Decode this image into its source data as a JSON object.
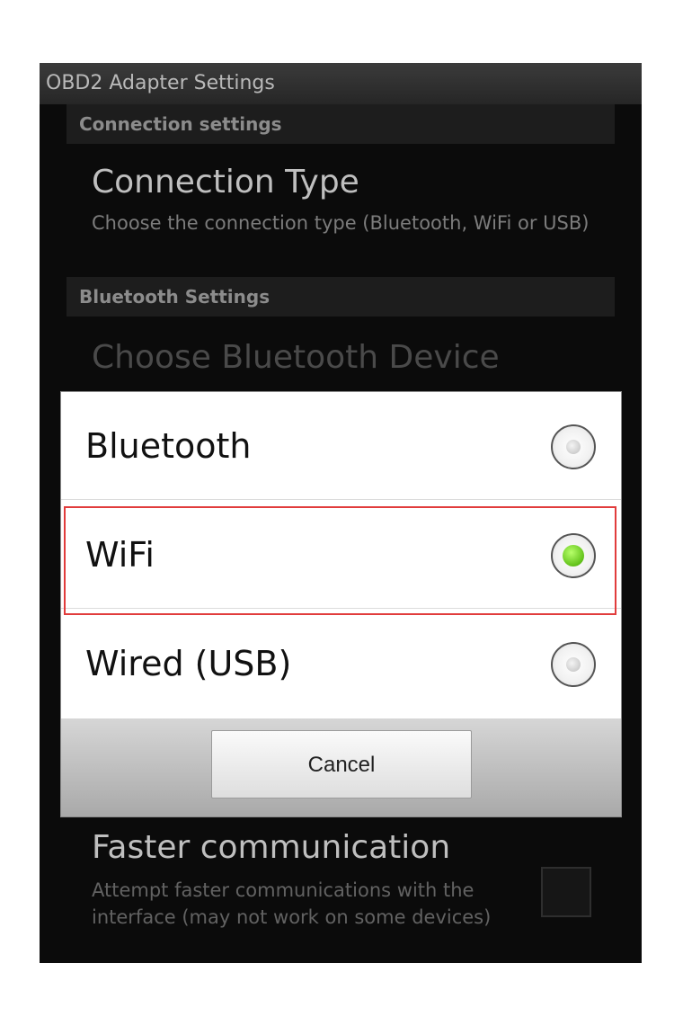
{
  "window": {
    "title": "OBD2 Adapter Settings"
  },
  "sections": {
    "connection": {
      "header": "Connection settings",
      "connection_type": {
        "title": "Connection Type",
        "summary": "Choose the connection type (Bluetooth, WiFi or USB)"
      }
    },
    "bluetooth": {
      "header": "Bluetooth Settings",
      "choose_device": {
        "title": "Choose Bluetooth Device"
      }
    },
    "advanced": {
      "faster_communication": {
        "title": "Faster communication",
        "summary": "Attempt faster communications with the interface (may not work on some devices)",
        "checked": false
      }
    }
  },
  "dialog": {
    "options": [
      {
        "label": "Bluetooth",
        "selected": false
      },
      {
        "label": "WiFi",
        "selected": true
      },
      {
        "label": "Wired (USB)",
        "selected": false
      }
    ],
    "cancel_label": "Cancel"
  },
  "colors": {
    "selected_radio": "#62c21a",
    "highlight_border": "#e13c3c",
    "screen_background": "#0b0b0b"
  }
}
